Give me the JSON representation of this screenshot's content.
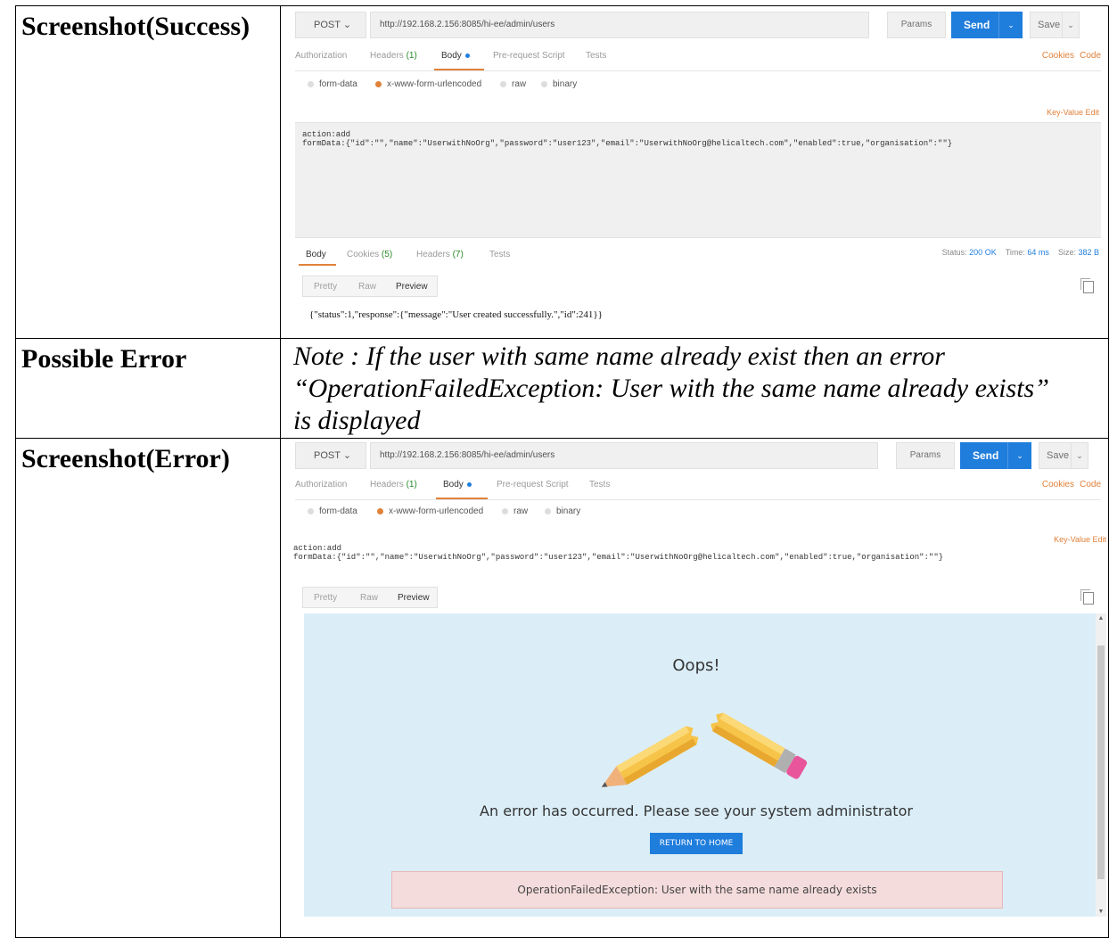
{
  "labels": {
    "success": "Screenshot(Success)",
    "possible_error": "Possible Error",
    "error": "Screenshot(Error)"
  },
  "note": {
    "line1": "Note : If the user with same name already exist then an error",
    "line2": "“OperationFailedException: User with the same name already exists”",
    "line3": "is displayed"
  },
  "postman": {
    "method": "POST",
    "url": "http://192.168.2.156:8085/hi-ee/admin/users",
    "params": "Params",
    "send": "Send",
    "save": "Save",
    "tabs": {
      "authorization": "Authorization",
      "headers": "Headers",
      "headers_count": "(1)",
      "body": "Body",
      "prerequest": "Pre-request Script",
      "tests": "Tests"
    },
    "cookies": "Cookies",
    "code": "Code",
    "body_types": {
      "form_data": "form-data",
      "urlencoded": "x-www-form-urlencoded",
      "raw": "raw",
      "binary": "binary"
    },
    "key_value_edit": "Key-Value Edit",
    "request_body_line1": "action:add",
    "request_body_line2": "formData:{\"id\":\"\",\"name\":\"UserwithNoOrg\",\"password\":\"user123\",\"email\":\"UserwithNoOrg@helicaltech.com\",\"enabled\":true,\"organisation\":\"\"}",
    "response_tabs": {
      "body": "Body",
      "cookies": "Cookies",
      "cookies_count": "(5)",
      "headers": "Headers",
      "headers_count": "(7)",
      "tests": "Tests"
    },
    "status_label": "Status:",
    "status_value": "200 OK",
    "time_label": "Time:",
    "time_value": "64 ms",
    "size_label": "Size:",
    "size_value": "382 B",
    "view_modes": {
      "pretty": "Pretty",
      "raw": "Raw",
      "preview": "Preview"
    },
    "response_success": "{\"status\":1,\"response\":{\"message\":\"User created successfully.\",\"id\":241}}"
  },
  "error_page": {
    "title": "Oops!",
    "message": "An error has occurred. Please see your system administrator",
    "button": "RETURN TO HOME",
    "exception": "OperationFailedException: User with the same name already exists"
  },
  "colors": {
    "accent_blue": "#1f7ddc",
    "accent_orange": "#e0813a",
    "error_background": "#dbeef8",
    "exception_background": "#f5dcdc"
  }
}
